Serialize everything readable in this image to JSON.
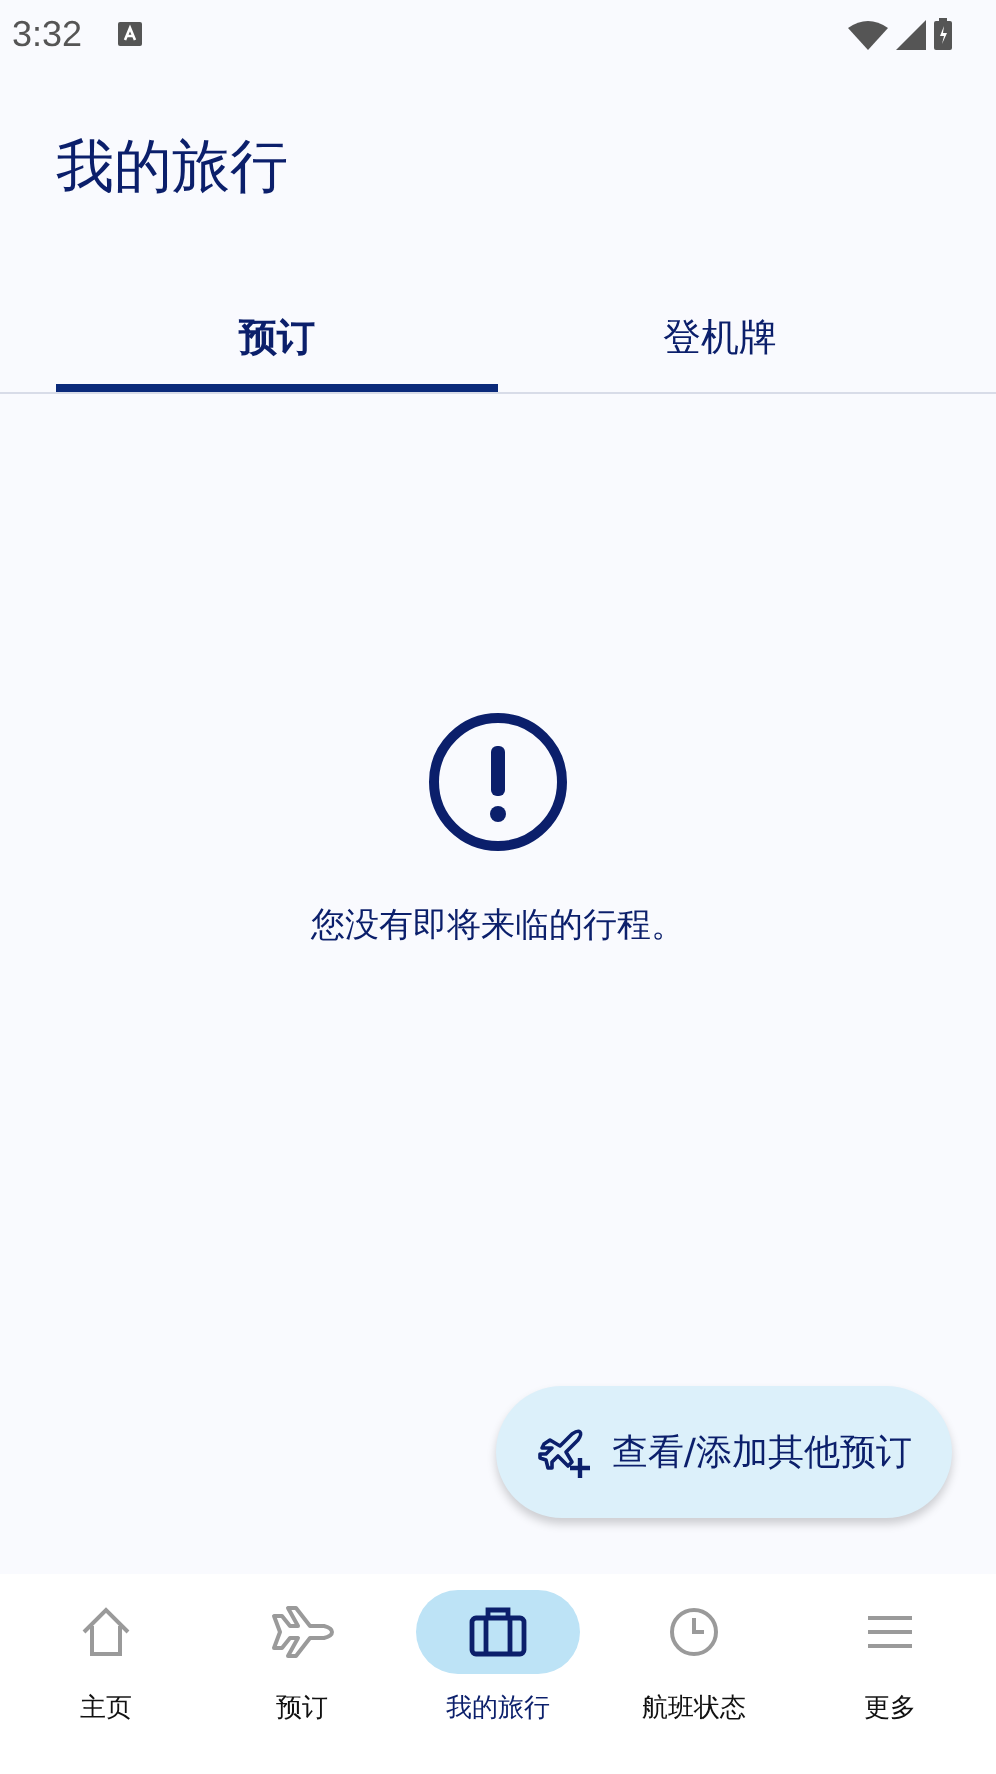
{
  "status_bar": {
    "time": "3:32"
  },
  "header": {
    "title": "我的旅行"
  },
  "tabs": [
    {
      "label": "预订",
      "selected": true
    },
    {
      "label": "登机牌",
      "selected": false
    }
  ],
  "empty_state": {
    "message": "您没有即将来临的行程。"
  },
  "fab": {
    "label": "查看/添加其他预订"
  },
  "bottom_nav": [
    {
      "kind": "home",
      "label": "主页",
      "selected": false
    },
    {
      "kind": "plane",
      "label": "预订",
      "selected": false
    },
    {
      "kind": "bag",
      "label": "我的旅行",
      "selected": true
    },
    {
      "kind": "clock",
      "label": "航班状态",
      "selected": false
    },
    {
      "kind": "menu",
      "label": "更多",
      "selected": false
    }
  ]
}
